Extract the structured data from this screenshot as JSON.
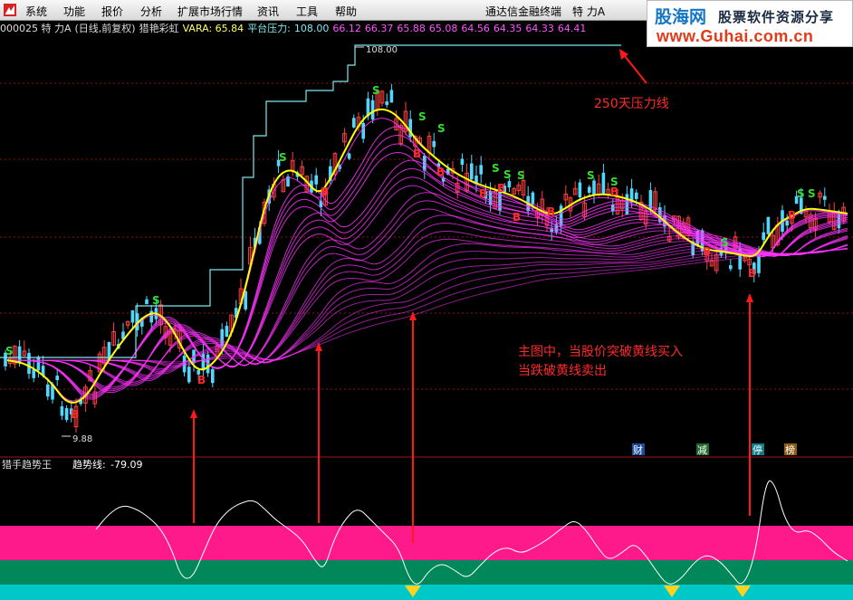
{
  "menu": {
    "items": [
      "系统",
      "功能",
      "报价",
      "分析",
      "扩展市场行情",
      "资讯",
      "工具",
      "帮助"
    ],
    "terminal_title": "通达信金融终端",
    "stock_name": "特 力A"
  },
  "brand": {
    "name": "股海网",
    "slogan": "股票软件资源分享",
    "url": "www.Guhai.com.cn"
  },
  "info": {
    "code_name": "000025 特 力A",
    "period": "(日线,前复权)",
    "indicator": "猎艳彩虹",
    "vara": "VARA: 65.84",
    "pressure_label": "平台压力:",
    "pressure_value": "108.00",
    "levels": [
      "66.12",
      "66.37",
      "65.88",
      "65.08",
      "64.56",
      "64.35",
      "64.33",
      "64.41"
    ]
  },
  "price_chart": {
    "high_label": "108.00",
    "low_label": "9.88",
    "annotation_pressure": "250天压力线",
    "annotation_rule_1": "主图中，当股价突破黄线买入",
    "annotation_rule_2": "当跌破黄线卖出",
    "buy_mark": "B",
    "sell_mark": "S",
    "badges": [
      "财",
      "减",
      "停",
      "榜"
    ]
  },
  "sub_chart": {
    "name": "猎手趋势王",
    "trend_label": "趋势线:",
    "trend_value": "-79.09"
  },
  "colors": {
    "pressure_line": "#7fe8f0",
    "yellow_line": "#ffff00",
    "rainbow": "#ff33ff",
    "arrow": "#ff1a1a",
    "band_pink": "#ff1a8c",
    "band_green": "#00875a",
    "band_cyan": "#00c8c8",
    "sell_signal": "#33dd33",
    "buy_signal": "#ff2a2a"
  }
}
